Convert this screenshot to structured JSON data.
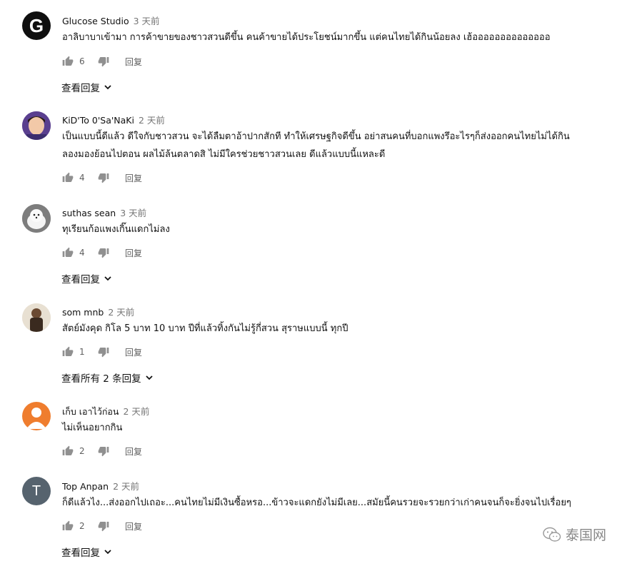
{
  "comments": [
    {
      "author": "Glucose Studio",
      "time": "3 天前",
      "text_lines": [
        "อาลิบาบาเข้ามา การค้าขายของชาวสวนดีขึ้น คนค้าขายได้ประโยชน์มากขึ้น แต่คนไทยได้กินน้อยลง เฮ้ออออออออออออออ"
      ],
      "likes": "6",
      "reply_label": "回复",
      "view_replies": "查看回复",
      "avatar_letter": "G"
    },
    {
      "author": "KiD'To 0'Sa'NaKi",
      "time": "2 天前",
      "text_lines": [
        "เป็นแบบนี้ดีแล้ว ดีใจกับชาวสวน จะได้ลืมตาอ้าปากสักที ทำให้เศรษฐกิจดีขึ้น อย่าสนคนที่บอกแพงรึอะไรๆก็ส่งออกคนไทยไม่ได้กิน",
        "ลองมองย้อนไปตอน ผลไม้ล้นตลาดสิ ไม่มีใครช่วยชาวสวนเลย ดีแล้วแบบนี้แหละดี"
      ],
      "likes": "4",
      "reply_label": "回复"
    },
    {
      "author": "suthas sean",
      "time": "3 天前",
      "text_lines": [
        "ทุเรียนก้อแพงเกิ๊นแดกไม่ลง"
      ],
      "likes": "4",
      "reply_label": "回复",
      "view_replies": "查看回复"
    },
    {
      "author": "som mnb",
      "time": "2 天前",
      "text_lines": [
        "สัตย์มังคุด กิโล 5 บาท 10 บาท ปีที่แล้วทิ้งกันไม่รู้กี่สวน สุราษแบบนี้ ทุกปี"
      ],
      "likes": "1",
      "reply_label": "回复",
      "view_replies": "查看所有 2 条回复"
    },
    {
      "author": "เก็บ เอาไว้ก่อน",
      "time": "2 天前",
      "text_lines": [
        "ไม่เห็นอยากกิน"
      ],
      "likes": "2",
      "reply_label": "回复"
    },
    {
      "author": "Top Anpan",
      "time": "2 天前",
      "text_lines": [
        "ก็ดีแล้วไง...ส่งออกไปเถอะ...คนไทยไม่มีเงินซื้อหรอ...ข้าวจะแดกยังไม่มีเลย...สมัยนี้คนรวยจะรวยกว่าเก่าคนจนก็จะยิ่งจนไปเรื่อยๆ"
      ],
      "likes": "2",
      "reply_label": "回复",
      "view_replies": "查看回复",
      "avatar_letter": "T"
    }
  ],
  "watermark": {
    "text": "泰国网"
  },
  "colors": {
    "text": "#111111",
    "secondary": "#757575",
    "icon": "#909090",
    "orange_avatar": "#ef7d2e",
    "slate_avatar": "#56636e"
  }
}
